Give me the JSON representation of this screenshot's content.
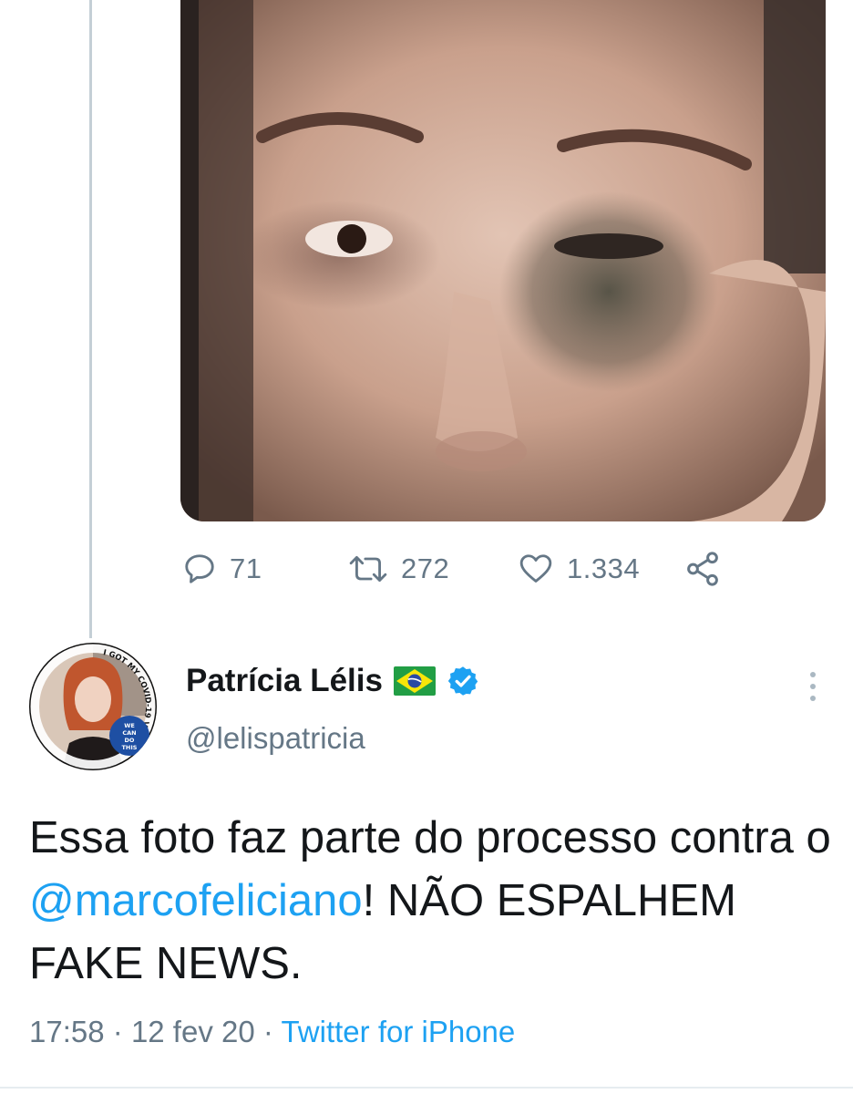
{
  "colors": {
    "text_primary": "#14171a",
    "text_secondary": "#657786",
    "link": "#1da1f2",
    "verified": "#1da1f2",
    "thread_line": "#c4cfd6"
  },
  "previous_tweet": {
    "media": {
      "icon": "photo-of-face-with-bruised-eye"
    },
    "actions": {
      "reply": {
        "icon": "reply-icon",
        "count": "71"
      },
      "retweet": {
        "icon": "retweet-icon",
        "count": "272"
      },
      "like": {
        "icon": "heart-icon",
        "count": "1.334"
      },
      "share": {
        "icon": "share-icon"
      }
    }
  },
  "tweet": {
    "author": {
      "display_name": "Patrícia Lélis",
      "flag": "brazil-flag-icon",
      "verified": true,
      "handle": "@lelispatricia",
      "avatar_text": {
        "ring": "I GOT MY COVID-19 VACCINE",
        "badge_lines": [
          "WE",
          "CAN",
          "DO",
          "THIS"
        ]
      }
    },
    "text": {
      "part1": "Essa foto faz parte do processo contra o ",
      "mention": "@marcofeliciano",
      "part2": "! NÃO ESPALHEM FAKE NEWS."
    },
    "meta": {
      "time": "17:58",
      "separator": "·",
      "date": "12 fev 20",
      "source": "Twitter for iPhone"
    }
  }
}
